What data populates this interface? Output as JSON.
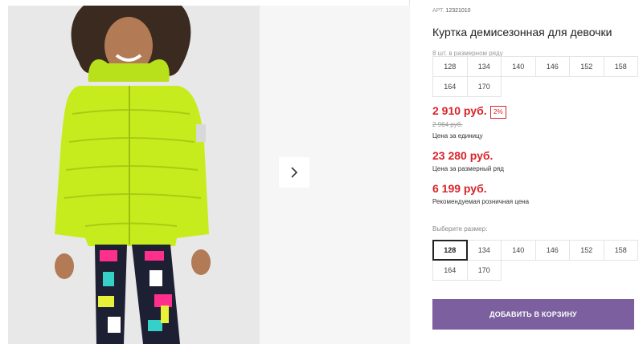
{
  "product": {
    "article_label": "АРТ.",
    "article": "12321010",
    "title": "Куртка демисезонная для девочки",
    "pack_note": "8 шт. в размерном ряду"
  },
  "size_row": [
    "128",
    "134",
    "140",
    "146",
    "152",
    "158",
    "164",
    "170"
  ],
  "prices": {
    "unit_price": "2 910 руб.",
    "discount": "2%",
    "old_price": "2 964 руб.",
    "unit_label": "Цена за единицу",
    "row_price": "23 280 руб.",
    "row_label": "Цена за размерный ряд",
    "retail_price": "6 199 руб.",
    "retail_label": "Рекомендуемая розничная цена"
  },
  "size_select": {
    "label": "Выберите размер:",
    "options": [
      "128",
      "134",
      "140",
      "146",
      "152",
      "158",
      "164",
      "170"
    ],
    "selected": "128"
  },
  "cart": {
    "add_label": "ДОБАВИТЬ В КОРЗИНУ"
  },
  "colors": {
    "accent_button": "#7b5f9e",
    "price_red": "#d8232a",
    "jacket_lime": "#c6ec1e"
  },
  "gallery": {
    "next_icon": "chevron-right-icon"
  }
}
